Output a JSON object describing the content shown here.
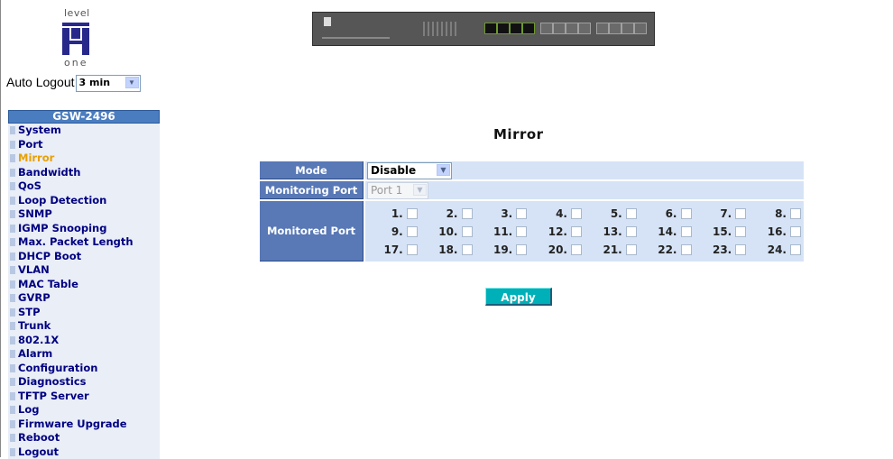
{
  "logo": {
    "top_text": "level",
    "bottom_text": "one"
  },
  "auto_logout": {
    "label": "Auto Logout",
    "value": "3 min"
  },
  "menu": {
    "header": "GSW-2496",
    "items": [
      "System",
      "Port",
      "Mirror",
      "Bandwidth",
      "QoS",
      "Loop Detection",
      "SNMP",
      "IGMP Snooping",
      "Max. Packet Length",
      "DHCP Boot",
      "VLAN",
      "MAC Table",
      "GVRP",
      "STP",
      "Trunk",
      "802.1X",
      "Alarm",
      "Configuration",
      "Diagnostics",
      "TFTP Server",
      "Log",
      "Firmware Upgrade",
      "Reboot",
      "Logout"
    ],
    "active": "Mirror"
  },
  "page": {
    "title": "Mirror"
  },
  "form": {
    "mode_label": "Mode",
    "mode_value": "Disable",
    "monitoring_label": "Monitoring Port",
    "monitoring_value": "Port 1",
    "monitored_label": "Monitored Port",
    "ports": [
      "1.",
      "2.",
      "3.",
      "4.",
      "5.",
      "6.",
      "7.",
      "8.",
      "9.",
      "10.",
      "11.",
      "12.",
      "13.",
      "14.",
      "15.",
      "16.",
      "17.",
      "18.",
      "19.",
      "20.",
      "21.",
      "22.",
      "23.",
      "24."
    ]
  },
  "apply_label": "Apply",
  "colors": {
    "label_bg": "#5878b6",
    "value_bg": "#d6e3f6",
    "menu_text": "#000080",
    "menu_active": "#e8a000",
    "apply_bg": "#00b0b8"
  }
}
